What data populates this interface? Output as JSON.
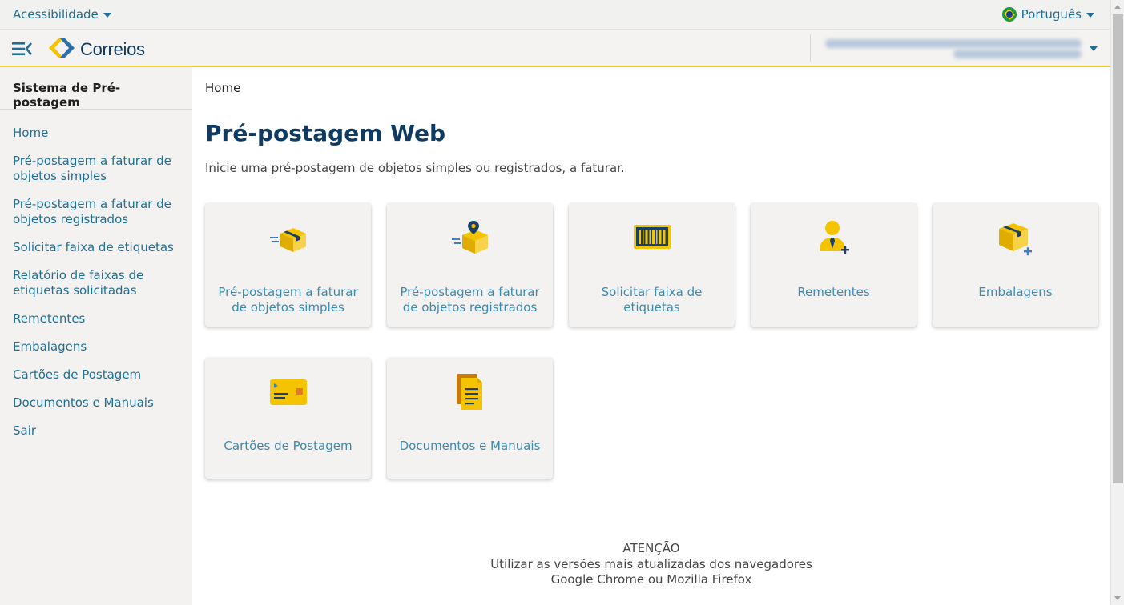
{
  "topbar": {
    "accessibility_label": "Acessibilidade",
    "language_label": "Português"
  },
  "header": {
    "logo_text": "Correios"
  },
  "sidebar": {
    "title": "Sistema de Pré-postagem",
    "items": [
      {
        "label": "Home"
      },
      {
        "label": "Pré-postagem a faturar de objetos simples"
      },
      {
        "label": "Pré-postagem a faturar de objetos registrados"
      },
      {
        "label": "Solicitar faixa de etiquetas"
      },
      {
        "label": "Relatório de faixas de etiquetas solicitadas"
      },
      {
        "label": "Remetentes"
      },
      {
        "label": "Embalagens"
      },
      {
        "label": "Cartões de Postagem"
      },
      {
        "label": "Documentos e Manuais"
      },
      {
        "label": "Sair"
      }
    ]
  },
  "main": {
    "breadcrumb": "Home",
    "title": "Pré-postagem Web",
    "description": "Inicie uma pré-postagem de objetos simples ou registrados, a faturar.",
    "cards": [
      {
        "label": "Pré-postagem a faturar de objetos simples",
        "icon": "package-icon"
      },
      {
        "label": "Pré-postagem a faturar de objetos registrados",
        "icon": "package-location-icon"
      },
      {
        "label": "Solicitar faixa de etiquetas",
        "icon": "barcode-icon"
      },
      {
        "label": "Remetentes",
        "icon": "sender-add-icon"
      },
      {
        "label": "Embalagens",
        "icon": "package-add-icon"
      },
      {
        "label": "Cartões de Postagem",
        "icon": "postal-card-icon"
      },
      {
        "label": "Documentos e Manuais",
        "icon": "documents-icon"
      }
    ],
    "notice": {
      "line1": "ATENÇÃO",
      "line2": "Utilizar as versões mais atualizadas dos navegadores",
      "line3": "Google Chrome ou Mozilla Firefox"
    }
  },
  "colors": {
    "brand_blue": "#0f3b63",
    "link_blue": "#1f6f94",
    "card_text": "#3b8ab0",
    "brand_yellow": "#f2cf2a"
  }
}
